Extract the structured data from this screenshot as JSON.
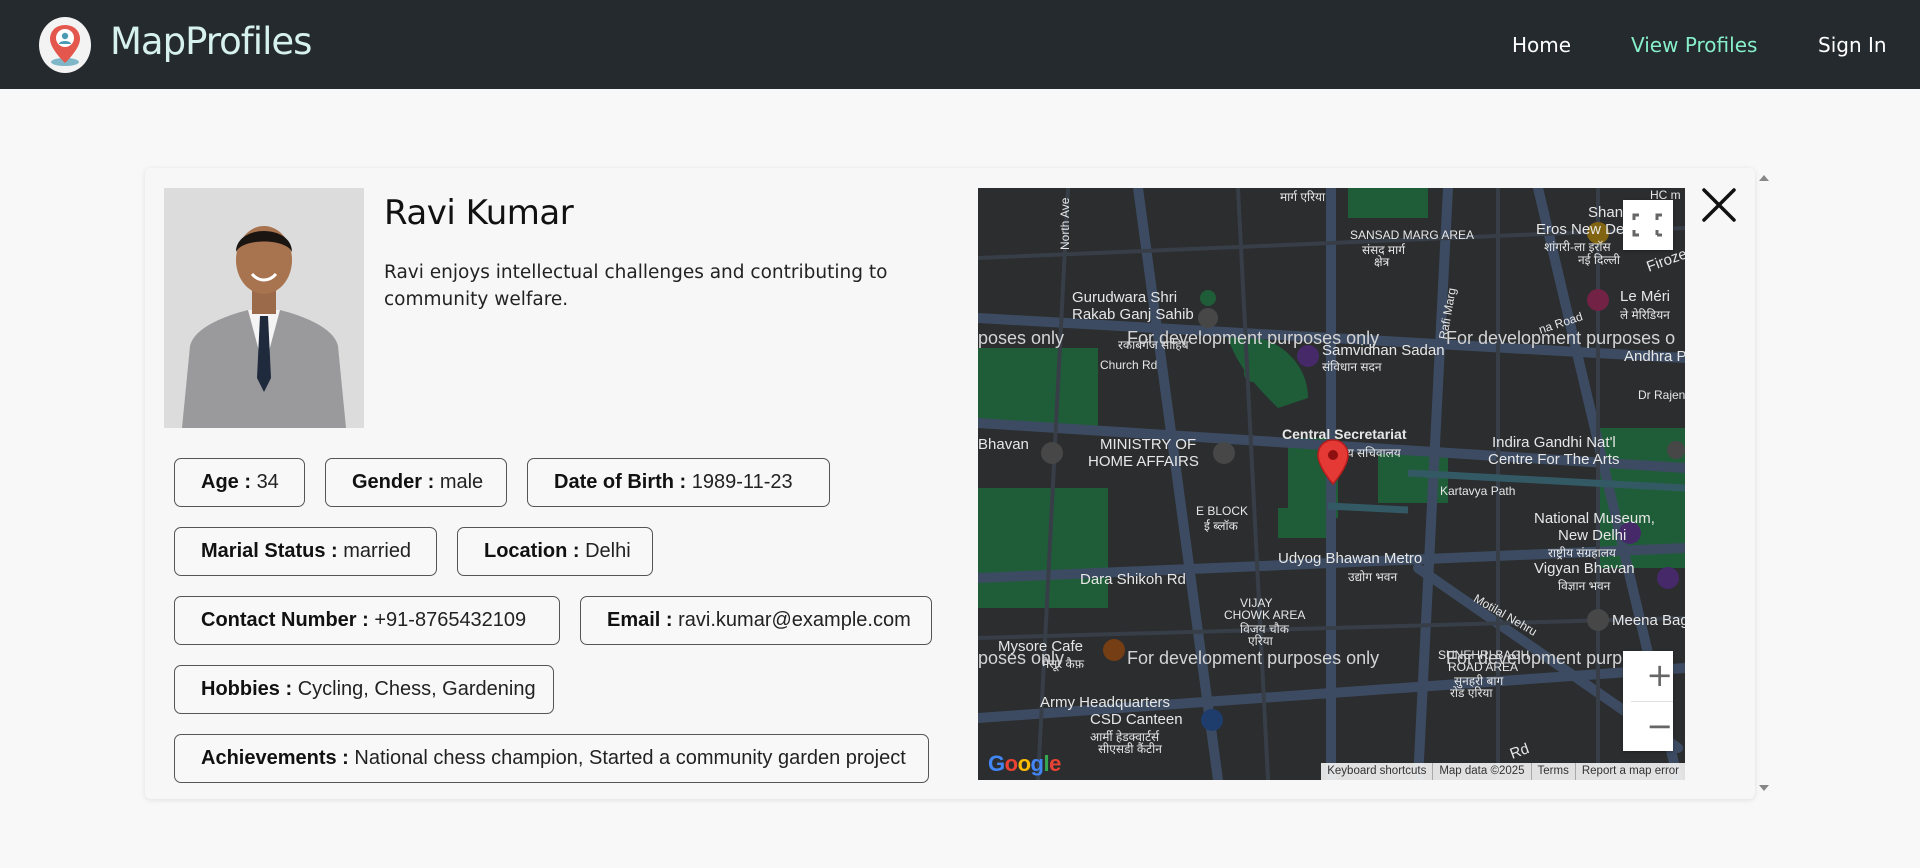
{
  "navbar": {
    "brand": "MapProfiles",
    "links": [
      {
        "label": "Home",
        "active": false
      },
      {
        "label": "View Profiles",
        "active": true
      },
      {
        "label": "Sign In",
        "active": false
      }
    ],
    "logo_icon": "map-pin-profile-icon"
  },
  "profile": {
    "name": "Ravi Kumar",
    "bio": "Ravi enjoys intellectual challenges and contributing to community welfare.",
    "fields": {
      "age": {
        "label": "Age :",
        "value": "34"
      },
      "gender": {
        "label": "Gender :",
        "value": "male"
      },
      "dob": {
        "label": "Date of Birth :",
        "value": "1989-11-23"
      },
      "marital": {
        "label": "Marial Status :",
        "value": "married"
      },
      "location": {
        "label": "Location :",
        "value": "Delhi"
      },
      "contact": {
        "label": "Contact Number :",
        "value": "+91-8765432109"
      },
      "email": {
        "label": "Email :",
        "value": "ravi.kumar@example.com"
      },
      "hobbies": {
        "label": "Hobbies :",
        "value": "Cycling, Chess, Gardening"
      },
      "achievements": {
        "label": "Achievements :",
        "value": "National chess champion, Started a community garden project"
      }
    }
  },
  "map": {
    "watermark": "For development purposes only",
    "watermark_left_fragment": "poses only",
    "watermark_right_fragment": "For development purposes o",
    "watermark_right_fragment_2": "For development purp",
    "labels": {
      "marg_eriya": "मार्ग एरिया",
      "sansad_marg_area": "SANSAD MARG AREA",
      "sansad_marg_hi": "संसद मार्ग",
      "kshetra": "क्षेत्र",
      "north_ave": "North Ave",
      "gurudwara": "Gurudwara Shri",
      "rakab": "Rakab Ganj Sahib",
      "rakab_hi": "रकाबगंज साहिब",
      "church_rd": "Church Rd",
      "rafi_marg": "Rafi Marg",
      "samvidhan": "Samvidhan Sadan",
      "samvidhan_hi": "संविधान सदन",
      "shangri": "Shangri-La",
      "eros": "Eros New Delhi",
      "eros_hi": "शांगरी-ला इरॉस",
      "nayi_delhi": "नई दिल्ली",
      "firoze": "Firoze",
      "le_meri": "Le Méri",
      "le_meri_hi": "ले मेरिडियन",
      "janpath": "na Road",
      "andhra": "Andhra P",
      "dr_rajen": "Dr Rajen",
      "bhavan": "Bhavan",
      "ministry": "MINISTRY OF",
      "home_affairs": "HOME AFFAIRS",
      "central_secretariat": "Central Secretariat",
      "central_sec_hi": "केंद्रीय सचिवालय",
      "indira": "Indira Gandhi Nat'l",
      "centre_arts": "Centre For The Arts",
      "kartavya": "Kartavya Path",
      "e_block": "E BLOCK",
      "e_block_hi": "ई ब्लॉक",
      "national_museum": "National Museum,",
      "new_delhi": "New Delhi",
      "rashtriya": "राष्ट्रीय संग्रहालय",
      "udyog": "Udyog Bhawan Metro",
      "udyog_hi": "उद्योग भवन",
      "dara": "Dara Shikoh Rd",
      "vigyan": "Vigyan Bhavan",
      "vigyan_hi": "विज्ञान भवन",
      "vijay_chowk": "VIJAY",
      "chowk_area": "CHOWK AREA",
      "vijay_hi": "विजय चौक",
      "eriya": "एरिया",
      "motilal": "Motilal Nehru",
      "meena": "Meena Bagh",
      "mysore": "Mysore Cafe",
      "mysore_hi": "मैसूर कैफ़",
      "sunehri": "SUNEHRI BAGH",
      "road_area": "ROAD AREA",
      "sunehri_hi": "सुनहरी बाग",
      "rod_eriya": "रोड एरिया",
      "army": "Army Headquarters",
      "csd": "CSD Canteen",
      "csd_hi": "आर्मी हेडक्वार्टर्स",
      "canteen_hi": "सीएसडी कैंटीन",
      "hc_m": "HC m",
      "rd": "Rd"
    },
    "footer": [
      "Keyboard shortcuts",
      "Map data ©2025",
      "Terms",
      "Report a map error"
    ],
    "google_logo": "Google",
    "controls": {
      "zoom_in": "+",
      "zoom_out": "−"
    },
    "icons": {
      "fullscreen": "fullscreen-icon",
      "marker": "location-marker-icon",
      "zoom_in": "plus-icon",
      "zoom_out": "minus-icon"
    }
  },
  "close_icon": "close-icon",
  "colors": {
    "navbar_bg": "#252a2e",
    "brand": "#d6f1ee",
    "active_link": "#86efc9",
    "map_bg": "#434549",
    "map_green": "#2f8f57",
    "map_road": "#5a7090",
    "marker": "#e53935"
  }
}
